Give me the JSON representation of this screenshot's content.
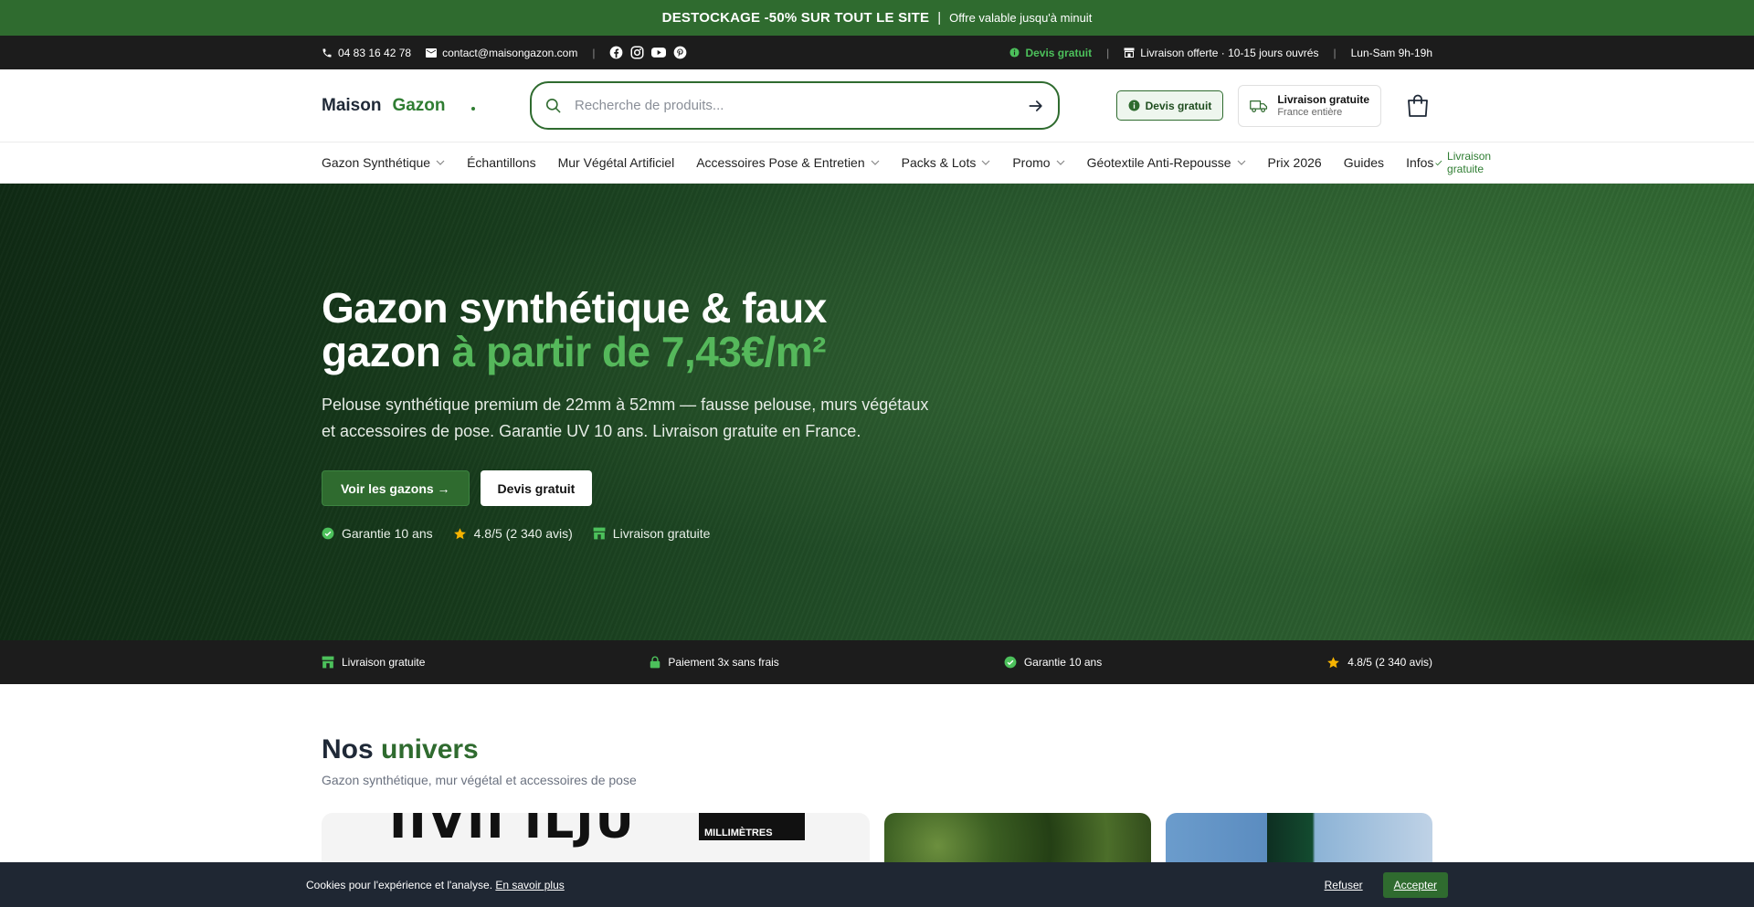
{
  "promo": {
    "main": "DESTOCKAGE -50% SUR TOUT LE SITE",
    "sep": "|",
    "sub": "Offre valable jusqu'à minuit"
  },
  "topbar": {
    "phone": "04 83 16 42 78",
    "email": "contact@maisongazon.com",
    "sep": "|",
    "devis": "Devis gratuit",
    "livraison": "Livraison offerte · 10-15 jours ouvrés",
    "hours": "Lun-Sam 9h-19h"
  },
  "header": {
    "logo_a": "Maison",
    "logo_b": "Gazon",
    "search_placeholder": "Recherche de produits...",
    "devis": "Devis gratuit",
    "livraison_title": "Livraison gratuite",
    "livraison_sub": "France entière"
  },
  "nav": {
    "items": [
      "Gazon Synthétique",
      "Échantillons",
      "Mur Végétal Artificiel",
      "Accessoires Pose & Entretien",
      "Packs & Lots",
      "Promo",
      "Géotextile Anti-Repousse",
      "Prix 2026",
      "Guides",
      "Infos"
    ],
    "extra": "Livraison gratuite"
  },
  "hero": {
    "title_a": "Gazon synthétique & faux",
    "title_b": "gazon",
    "title_hl": "à partir de 7,43€/m²",
    "desc": "Pelouse synthétique premium de 22mm à 52mm — fausse pelouse, murs végétaux et accessoires de pose. Garantie UV 10 ans. Livraison gratuite en France.",
    "btn_primary": "Voir les gazons →",
    "btn_secondary": "Devis gratuit",
    "badges": [
      "Garantie 10 ans",
      "4.8/5 (2 340 avis)",
      "Livraison gratuite"
    ]
  },
  "trust": [
    "Livraison gratuite",
    "Paiement 3x sans frais",
    "Garantie 10 ans",
    "4.8/5 (2 340 avis)"
  ],
  "univers": {
    "title_a": "Nos",
    "title_b": "univers",
    "subtitle": "Gazon synthétique, mur végétal et accessoires de pose",
    "card1_big": "IIVII ILJU",
    "card1_mm": "MILLIMÈTRES"
  },
  "cookie": {
    "text": "Cookies pour l'expérience et l'analyse.",
    "link": "En savoir plus",
    "refuse": "Refuser",
    "accept": "Accepter"
  },
  "colors": {
    "brand": "#2f6b2f",
    "accent_green": "#55b85b",
    "dark": "#1c1c1c"
  }
}
